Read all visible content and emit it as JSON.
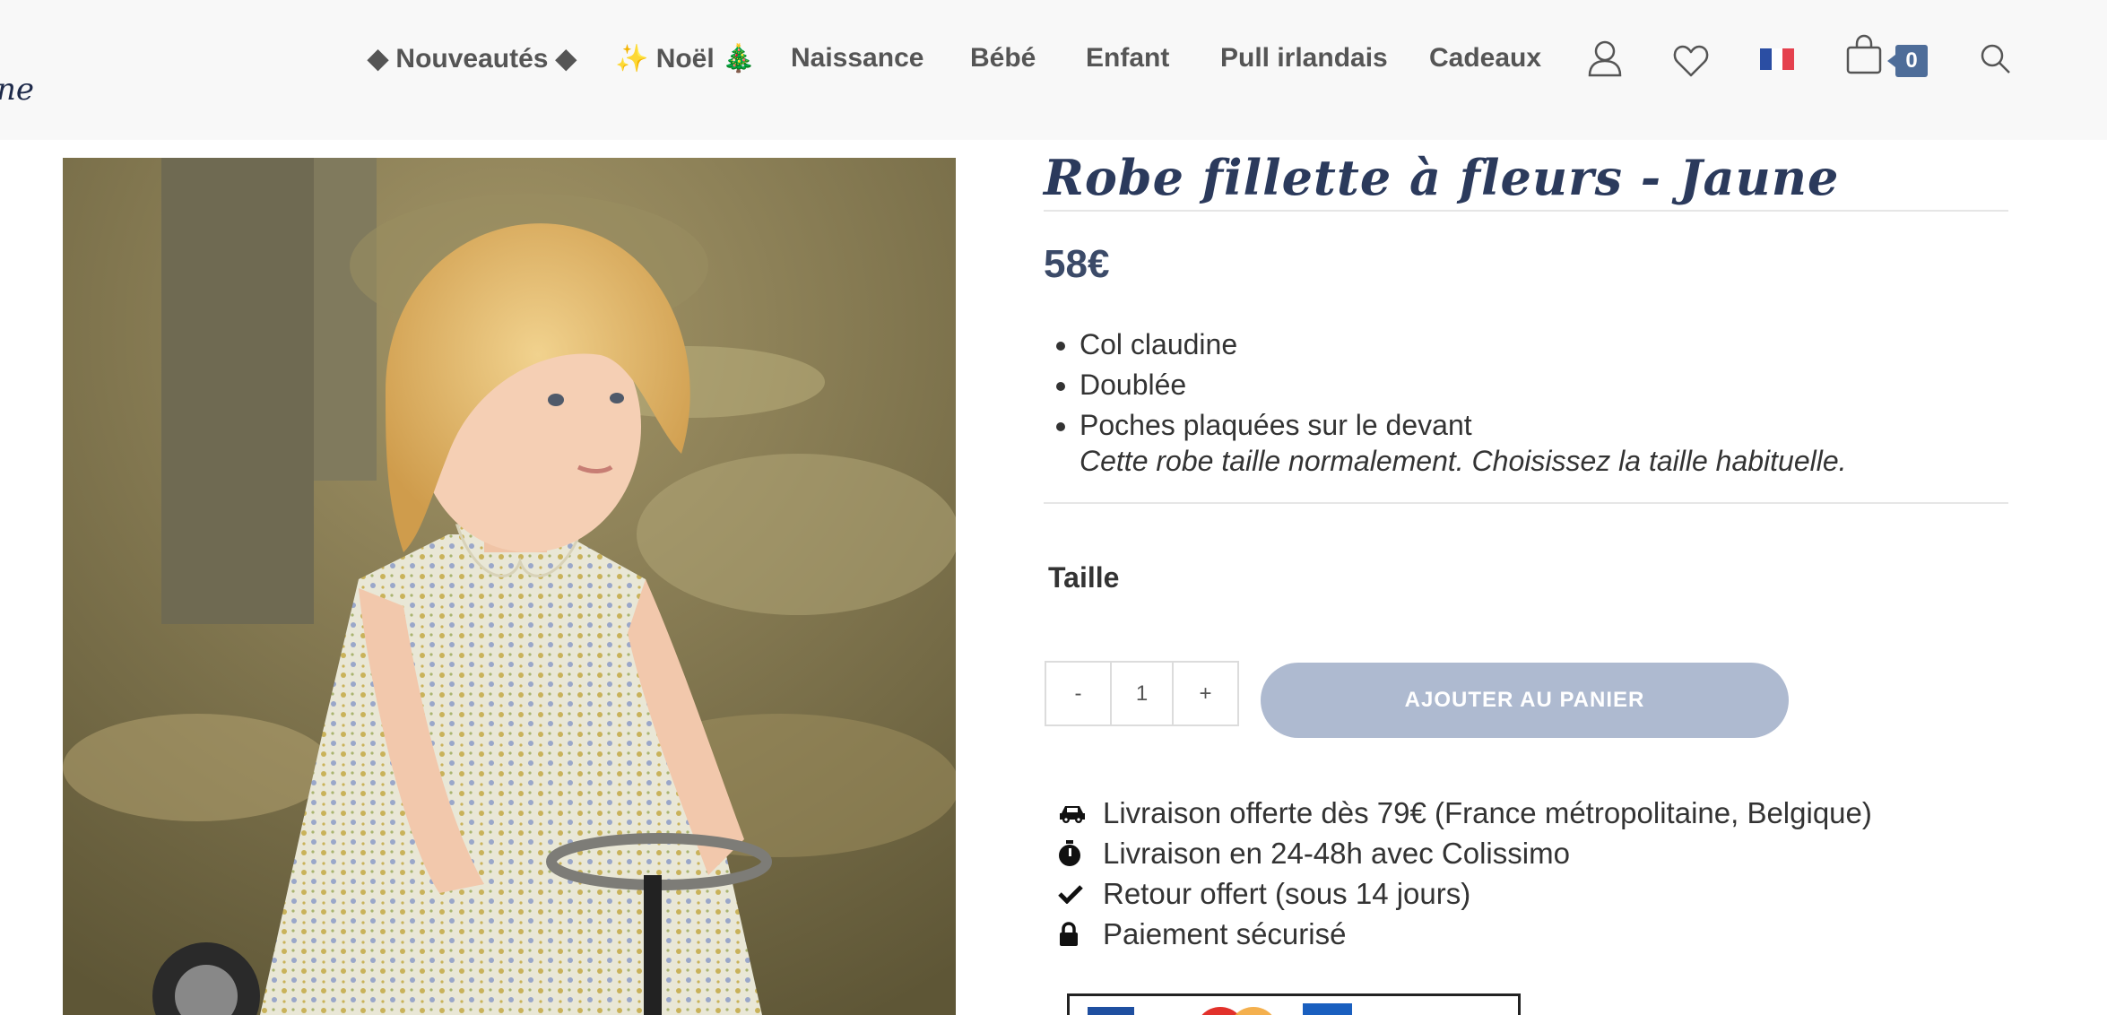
{
  "header": {
    "logo_fragment": "ne",
    "nav": [
      {
        "label": "◆ Nouveautés ◆"
      },
      {
        "label": "✨ Noël 🎄"
      },
      {
        "label": "Naissance"
      },
      {
        "label": "Bébé"
      },
      {
        "label": "Enfant"
      },
      {
        "label": "Pull irlandais"
      },
      {
        "label": "Cadeaux"
      }
    ],
    "icons": [
      "user-icon",
      "heart-icon",
      "france-flag-icon",
      "shopping-bag-icon",
      "search-icon"
    ],
    "cart_count": "0"
  },
  "product": {
    "title": "Robe fillette à fleurs - Jaune",
    "price": "58€",
    "details": [
      "Col claudine",
      "Doublée",
      "Poches plaquées sur le devant"
    ],
    "size_note": "Cette robe taille normalement. Choisissez la taille habituelle.",
    "size_label": "Taille",
    "quantity": {
      "minus": "-",
      "value": "1",
      "plus": "+"
    },
    "add_to_cart": "AJOUTER AU PANIER"
  },
  "features": [
    {
      "icon": "car-icon",
      "text": "Livraison offerte dès 79€ (France métropolitaine, Belgique)"
    },
    {
      "icon": "stopwatch-icon",
      "text": "Livraison en 24-48h avec Colissimo"
    },
    {
      "icon": "check-icon",
      "text": "Retour offert (sous 14 jours)"
    },
    {
      "icon": "lock-icon",
      "text": "Paiement sécurisé"
    }
  ],
  "colors": {
    "accent": "#4e6d99",
    "title": "#2b3a5c",
    "button": "#aebad0",
    "header_bg": "#f8f8f8"
  }
}
